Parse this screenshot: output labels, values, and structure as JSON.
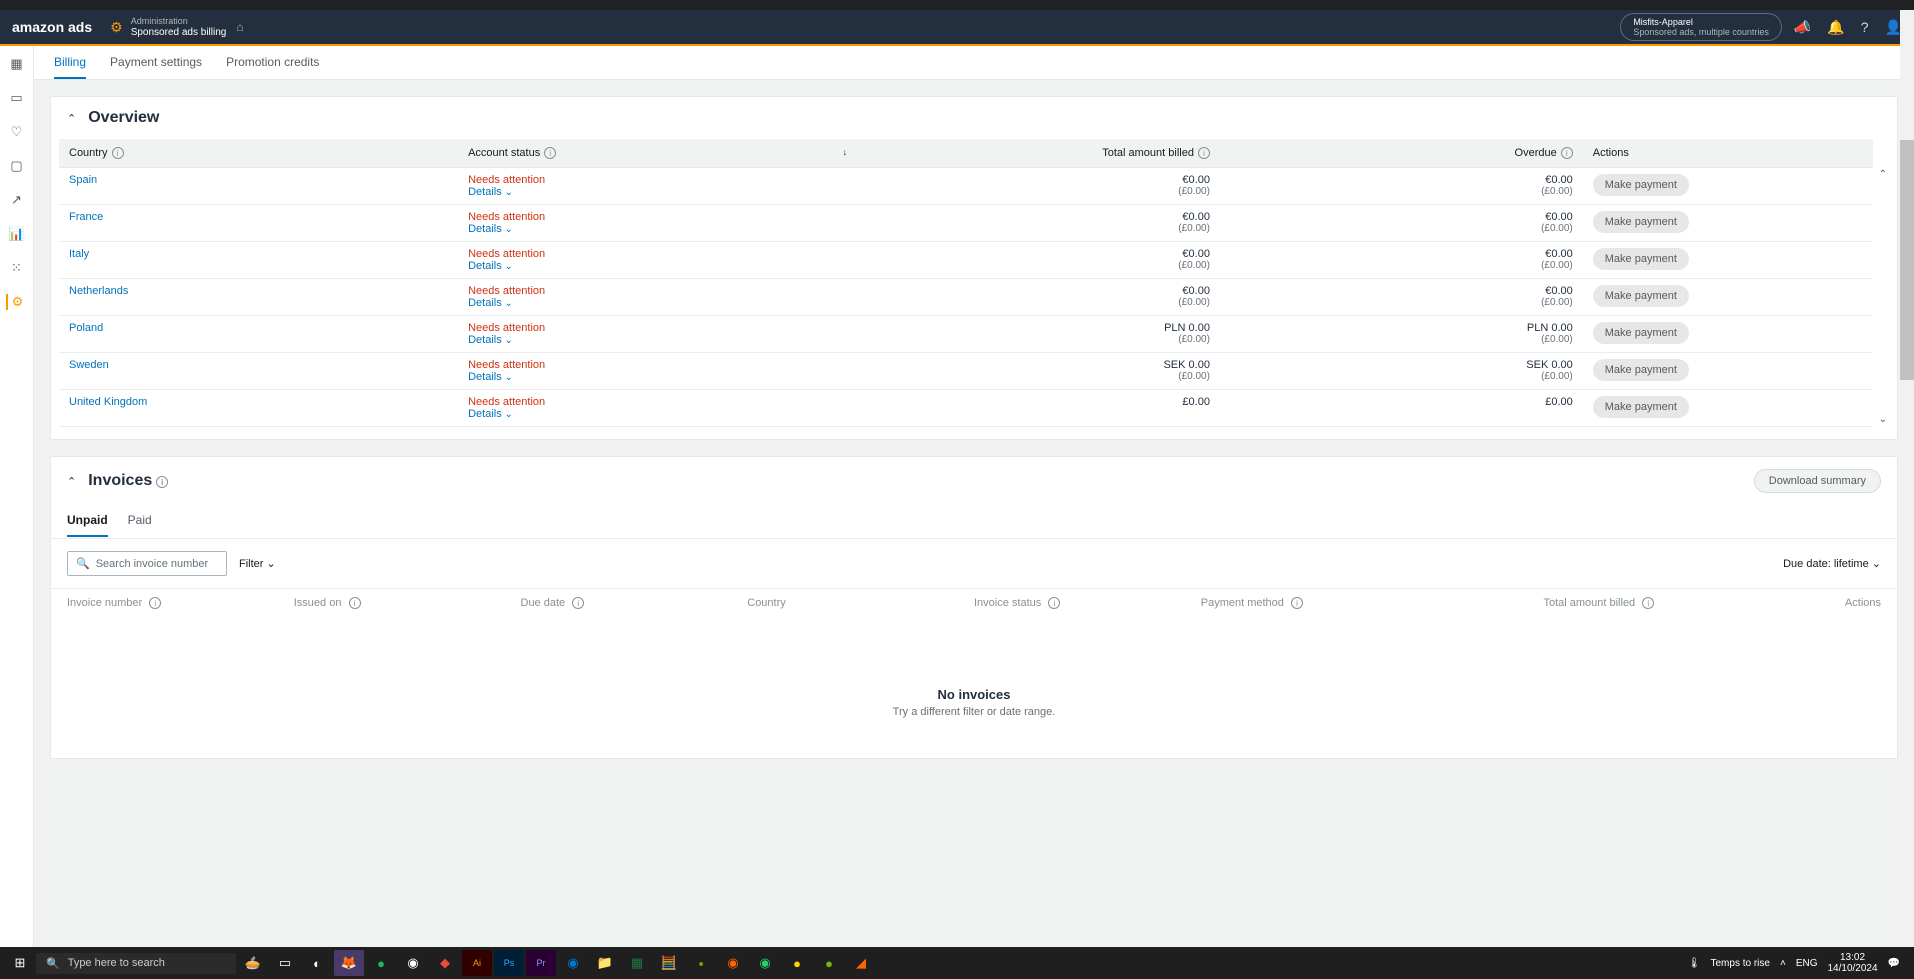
{
  "header": {
    "logo": "amazon ads",
    "breadcrumb_top": "Administration",
    "breadcrumb_main": "Sponsored ads billing",
    "account_name": "Misfits-Apparel",
    "account_sub": "Sponsored ads, multiple countries"
  },
  "tabs": {
    "billing": "Billing",
    "payment": "Payment settings",
    "promo": "Promotion credits"
  },
  "overview": {
    "title": "Overview",
    "cols": {
      "country": "Country",
      "status": "Account status",
      "billed": "Total amount billed",
      "overdue": "Overdue",
      "actions": "Actions"
    },
    "status_label": "Needs attention",
    "details_label": "Details",
    "pay_label": "Make payment",
    "rows": [
      {
        "country": "Spain",
        "billed": "€0.00",
        "billed_sub": "(£0.00)",
        "overdue": "€0.00",
        "overdue_sub": "(£0.00)"
      },
      {
        "country": "France",
        "billed": "€0.00",
        "billed_sub": "(£0.00)",
        "overdue": "€0.00",
        "overdue_sub": "(£0.00)"
      },
      {
        "country": "Italy",
        "billed": "€0.00",
        "billed_sub": "(£0.00)",
        "overdue": "€0.00",
        "overdue_sub": "(£0.00)"
      },
      {
        "country": "Netherlands",
        "billed": "€0.00",
        "billed_sub": "(£0.00)",
        "overdue": "€0.00",
        "overdue_sub": "(£0.00)"
      },
      {
        "country": "Poland",
        "billed": "PLN 0.00",
        "billed_sub": "(£0.00)",
        "overdue": "PLN 0.00",
        "overdue_sub": "(£0.00)"
      },
      {
        "country": "Sweden",
        "billed": "SEK 0.00",
        "billed_sub": "(£0.00)",
        "overdue": "SEK 0.00",
        "overdue_sub": "(£0.00)"
      },
      {
        "country": "United Kingdom",
        "billed": "£0.00",
        "billed_sub": "",
        "overdue": "£0.00",
        "overdue_sub": ""
      }
    ]
  },
  "invoices": {
    "title": "Invoices",
    "download": "Download summary",
    "tab_unpaid": "Unpaid",
    "tab_paid": "Paid",
    "search_placeholder": "Search invoice number",
    "filter": "Filter",
    "due_date": "Due date: lifetime",
    "cols": {
      "num": "Invoice number",
      "issued": "Issued on",
      "due": "Due date",
      "country": "Country",
      "status": "Invoice status",
      "method": "Payment method",
      "billed": "Total amount billed",
      "actions": "Actions"
    },
    "empty_title": "No invoices",
    "empty_sub": "Try a different filter or date range."
  },
  "taskbar": {
    "search": "Type here to search",
    "weather": "Temps to rise",
    "lang": "ENG",
    "time": "13:02",
    "date": "14/10/2024"
  }
}
